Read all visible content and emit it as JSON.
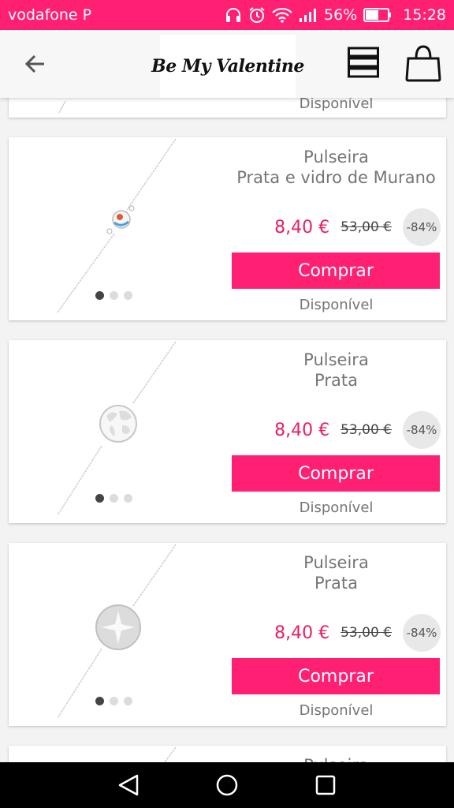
{
  "status_bar": {
    "carrier": "vodafone P",
    "battery": "56%",
    "time": "15:28",
    "background": "#ff1f73"
  },
  "header": {
    "logo_text": "Be My Valentine"
  },
  "products": [
    {
      "title_line1": "",
      "title_line2": "",
      "price": "",
      "old_price": "",
      "discount": "",
      "buy_label": "",
      "availability": "Disponível"
    },
    {
      "title_line1": "Pulseira",
      "title_line2": "Prata e vidro de Murano",
      "price": "8,40 €",
      "old_price": "53,00 €",
      "discount": "-84%",
      "buy_label": "Comprar",
      "availability": "Disponível"
    },
    {
      "title_line1": "Pulseira",
      "title_line2": "Prata",
      "price": "8,40 €",
      "old_price": "53,00 €",
      "discount": "-84%",
      "buy_label": "Comprar",
      "availability": "Disponível"
    },
    {
      "title_line1": "Pulseira",
      "title_line2": "Prata",
      "price": "8,40 €",
      "old_price": "53,00 €",
      "discount": "-84%",
      "buy_label": "Comprar",
      "availability": "Disponível"
    },
    {
      "title_line1": "Pulseira",
      "title_line2": "",
      "price": "",
      "old_price": "",
      "discount": "",
      "buy_label": "",
      "availability": ""
    }
  ],
  "colors": {
    "accent": "#ff1f73",
    "price": "#e91e63"
  }
}
